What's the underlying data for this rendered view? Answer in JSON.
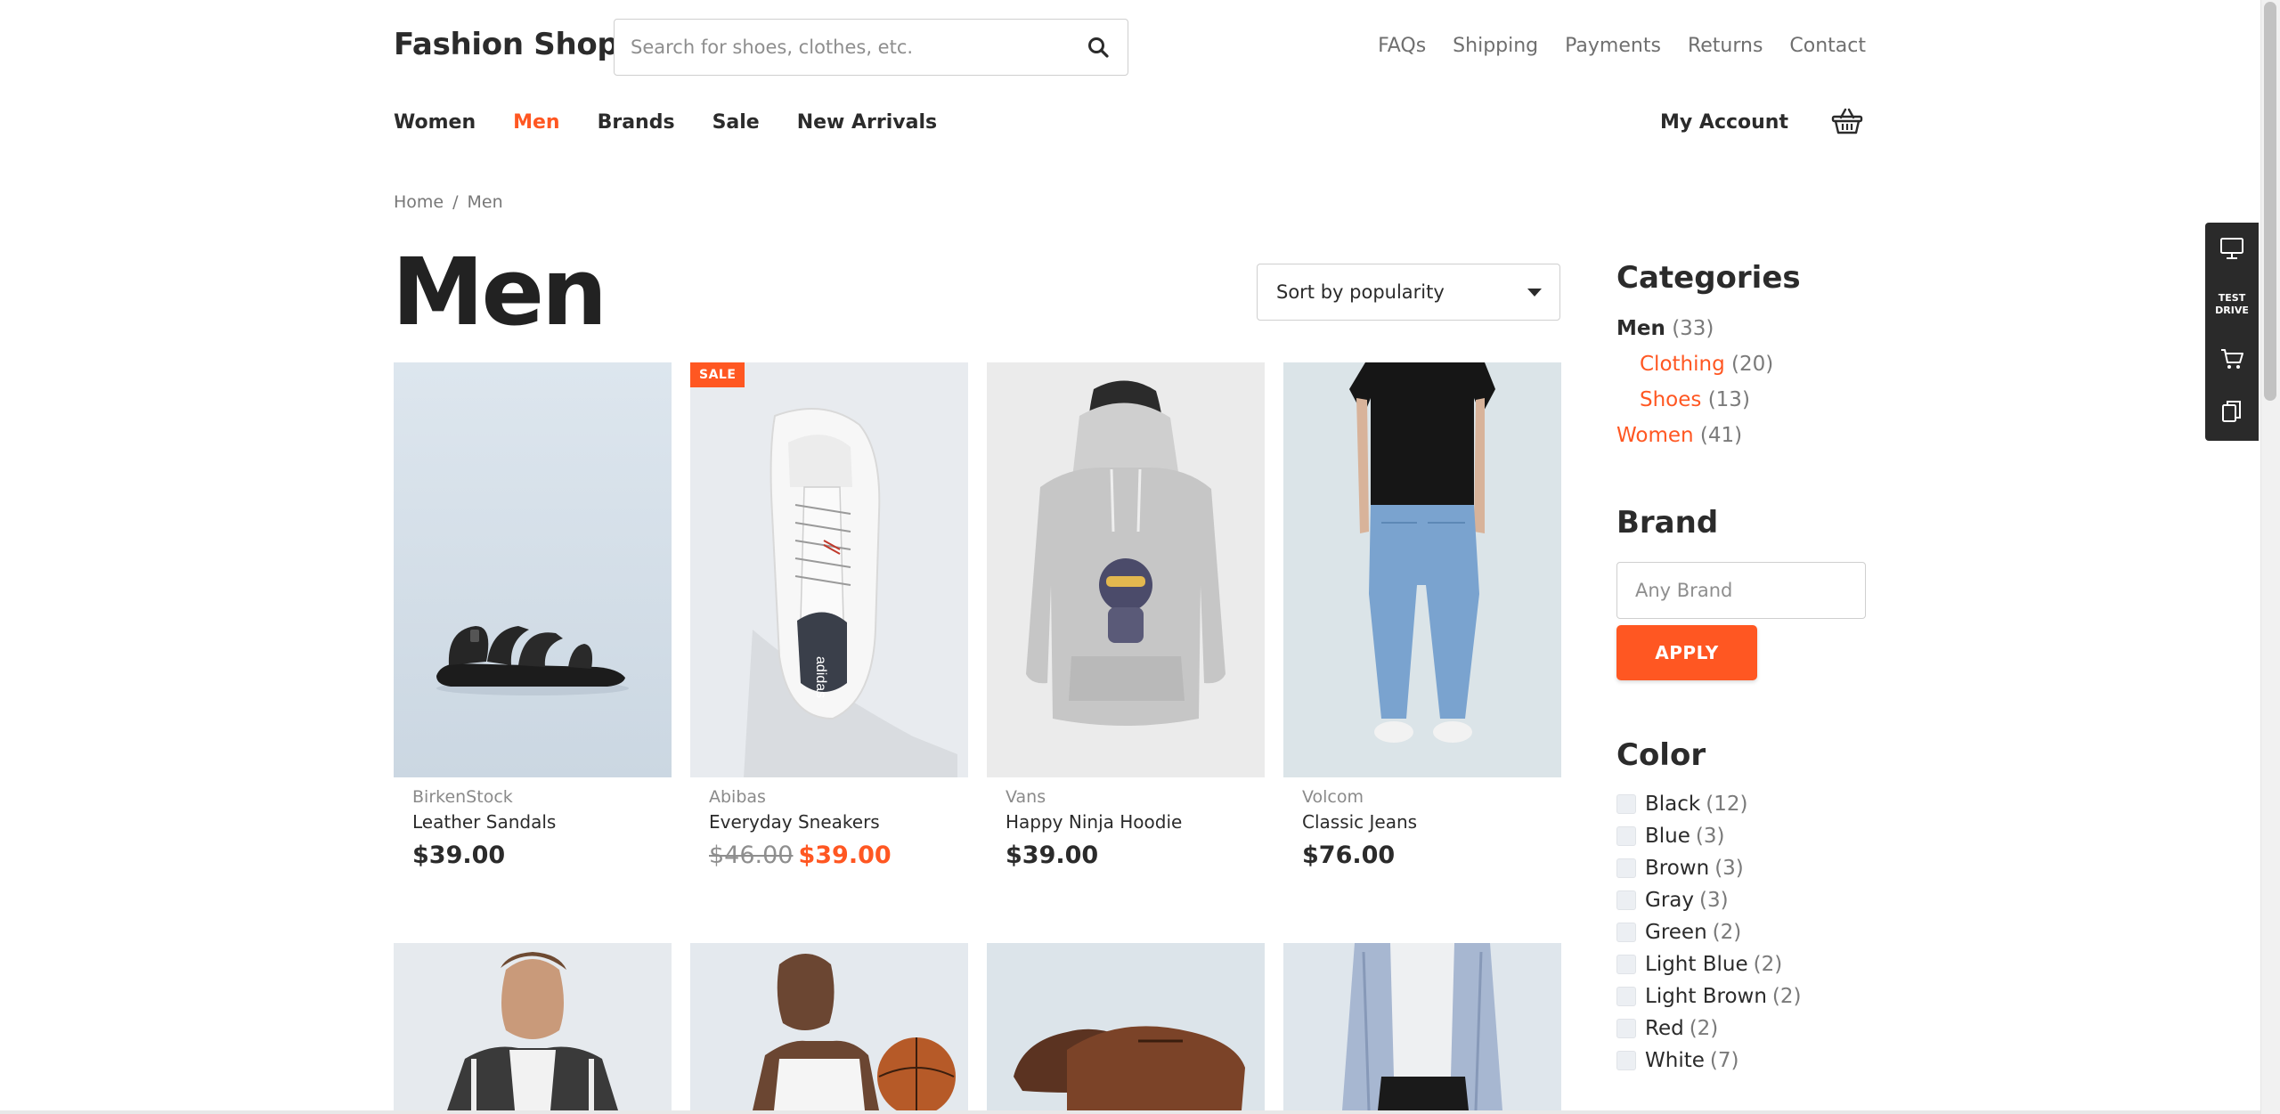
{
  "header": {
    "logo": "Fashion Shop",
    "search_placeholder": "Search for shoes, clothes, etc.",
    "utility_links": [
      "FAQs",
      "Shipping",
      "Payments",
      "Returns",
      "Contact"
    ],
    "nav": [
      "Women",
      "Men",
      "Brands",
      "Sale",
      "New Arrivals"
    ],
    "nav_active": "Men",
    "account_label": "My Account"
  },
  "breadcrumb": {
    "home": "Home",
    "separator": "/",
    "current": "Men"
  },
  "page_title": "Men",
  "sort": {
    "selected": "Sort by popularity"
  },
  "products": [
    {
      "brand": "BirkenStock",
      "name": "Leather Sandals",
      "price": "$39.00",
      "sale": false
    },
    {
      "brand": "Abibas",
      "name": "Everyday Sneakers",
      "old_price": "$46.00",
      "price": "$39.00",
      "sale": true,
      "badge": "SALE"
    },
    {
      "brand": "Vans",
      "name": "Happy Ninja Hoodie",
      "price": "$39.00",
      "sale": false
    },
    {
      "brand": "Volcom",
      "name": "Classic Jeans",
      "price": "$76.00",
      "sale": false
    }
  ],
  "sidebar": {
    "categories_title": "Categories",
    "categories": [
      {
        "label": "Men",
        "count": "(33)"
      },
      {
        "label": "Clothing",
        "count": "(20)"
      },
      {
        "label": "Shoes",
        "count": "(13)"
      },
      {
        "label": "Women",
        "count": "(41)"
      }
    ],
    "brand_title": "Brand",
    "brand_placeholder": "Any Brand",
    "apply_label": "APPLY",
    "color_title": "Color",
    "colors": [
      {
        "label": "Black",
        "count": "(12)"
      },
      {
        "label": "Blue",
        "count": "(3)"
      },
      {
        "label": "Brown",
        "count": "(3)"
      },
      {
        "label": "Gray",
        "count": "(3)"
      },
      {
        "label": "Green",
        "count": "(2)"
      },
      {
        "label": "Light Blue",
        "count": "(2)"
      },
      {
        "label": "Light Brown",
        "count": "(2)"
      },
      {
        "label": "Red",
        "count": "(2)"
      },
      {
        "label": "White",
        "count": "(7)"
      }
    ]
  },
  "dock": {
    "test_drive_line1": "TEST",
    "test_drive_line2": "DRIVE"
  },
  "theme": {
    "accent": "#ff5722",
    "text": "#2b2b2b",
    "muted": "#7a7a7a"
  }
}
